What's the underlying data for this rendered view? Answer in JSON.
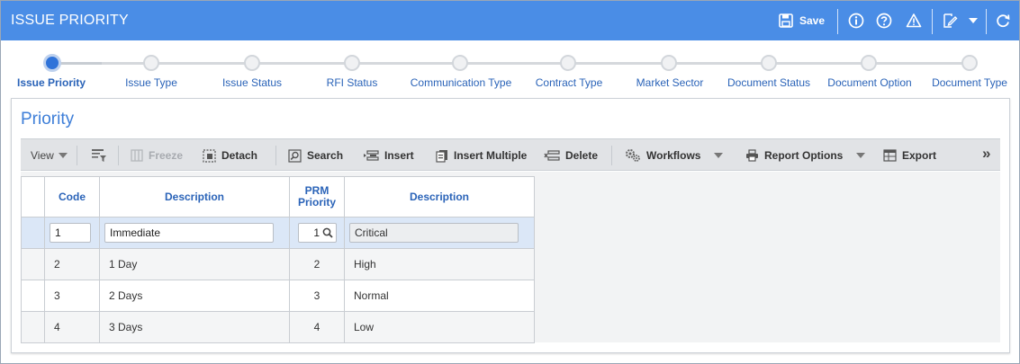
{
  "header": {
    "title": "ISSUE PRIORITY",
    "save_label": "Save",
    "icons": [
      "save-icon",
      "info-icon",
      "help-icon",
      "warning-icon",
      "edit-icon",
      "chevron-down-icon",
      "refresh-icon"
    ]
  },
  "wizard": {
    "steps": [
      {
        "label": "Issue Priority",
        "active": true
      },
      {
        "label": "Issue Type",
        "active": false
      },
      {
        "label": "Issue Status",
        "active": false
      },
      {
        "label": "RFI Status",
        "active": false
      },
      {
        "label": "Communication Type",
        "active": false
      },
      {
        "label": "Contract Type",
        "active": false
      },
      {
        "label": "Market Sector",
        "active": false
      },
      {
        "label": "Document Status",
        "active": false
      },
      {
        "label": "Document Option",
        "active": false
      },
      {
        "label": "Document Type",
        "active": false
      }
    ]
  },
  "panel": {
    "title": "Priority"
  },
  "toolbar": {
    "view": "View",
    "freeze": "Freeze",
    "detach": "Detach",
    "search": "Search",
    "insert": "Insert",
    "insert_multiple": "Insert Multiple",
    "delete": "Delete",
    "workflows": "Workflows",
    "report_options": "Report Options",
    "export": "Export",
    "more": "»"
  },
  "grid": {
    "columns": [
      "Code",
      "Description",
      "PRM Priority",
      "Description"
    ],
    "prm_priority_header": {
      "line1": "PRM",
      "line2": "Priority"
    },
    "edit_row": {
      "code": "1",
      "description": "Immediate",
      "prm_priority": "1",
      "prm_description": "Critical"
    },
    "rows": [
      {
        "code": "2",
        "description": "1 Day",
        "prm_priority": "2",
        "prm_description": "High"
      },
      {
        "code": "3",
        "description": "2 Days",
        "prm_priority": "3",
        "prm_description": "Normal"
      },
      {
        "code": "4",
        "description": "3 Days",
        "prm_priority": "4",
        "prm_description": "Low"
      }
    ]
  },
  "colors": {
    "header_bg": "#4a8de6",
    "accent_text": "#2a63b8",
    "selected_row": "#dbe7f7"
  }
}
